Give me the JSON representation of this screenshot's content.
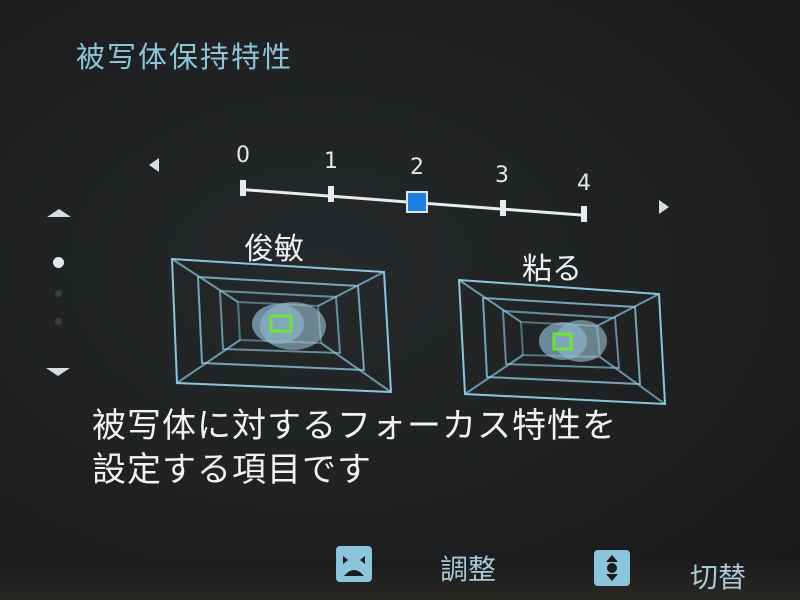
{
  "screen": {
    "title": "被写体保持特性",
    "description_line1": "被写体に対するフォーカス特性を",
    "description_line2": "設定する項目です"
  },
  "slider": {
    "ticks": [
      "0",
      "1",
      "2",
      "3",
      "4"
    ],
    "selected_value": 2,
    "accent_color": "#1f7fe0"
  },
  "options": [
    {
      "label": "俊敏"
    },
    {
      "label": "粘る"
    }
  ],
  "page_indicator": {
    "total": 3,
    "current": 1
  },
  "footer": {
    "adjust_label": "調整",
    "adjust_icon": "left-right-dial-icon",
    "switch_label": "切替",
    "switch_icon": "up-down-dial-icon"
  },
  "colors": {
    "title": "#8fc3d8",
    "text": "#f0f2f4",
    "frame": "#8cc4dc",
    "focus_frame": "#6fe23a"
  }
}
